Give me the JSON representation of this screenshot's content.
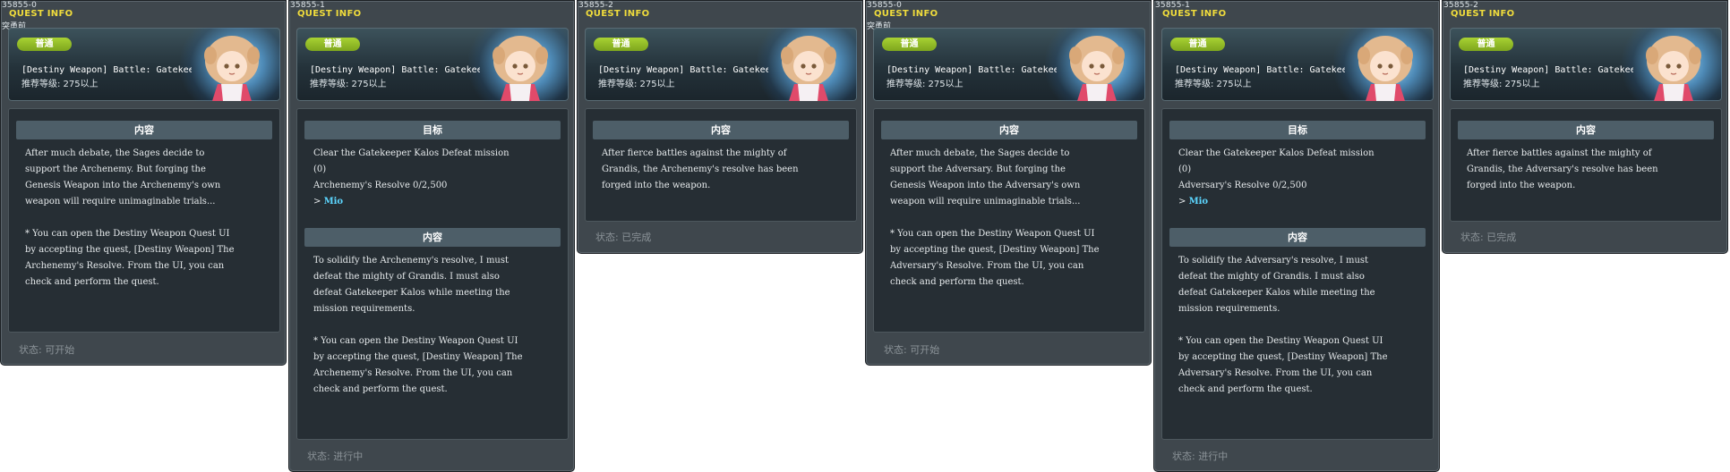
{
  "common": {
    "quest_info_label": "QUEST INFO",
    "badge": "普通",
    "title": "[Destiny Weapon] Battle: Gatekeeper Kalos",
    "level": "推荐等级: 275以上",
    "section_content": "内容",
    "section_goal": "目标"
  },
  "panels": [
    {
      "id": "35855-0",
      "subtitle": "突勇前",
      "sections": [
        {
          "header": "内容",
          "text": "After much debate, the Sages decide to\nsupport the Archenemy. But forging the\nGenesis Weapon into the Archenemy's own\nweapon will require unimaginable trials...\n\n * You can open the Destiny Weapon Quest UI\nby accepting the quest, [Destiny Weapon] The\nArchenemy's Resolve. From the UI, you can\ncheck and perform the quest."
        }
      ],
      "status": "状态: 可开始"
    },
    {
      "id": "35855-1",
      "goal_lines": [
        "Clear the Gatekeeper Kalos Defeat mission",
        "(0)",
        "Archenemy's Resolve 0/2,500"
      ],
      "goal_arrow": "> ",
      "goal_npc": "Mio",
      "content": "To solidify the Archenemy's resolve, I must\ndefeat the mighty of Grandis. I must also\ndefeat Gatekeeper Kalos while meeting the\nmission requirements.\n\n * You can open the Destiny Weapon Quest UI\nby accepting the quest, [Destiny Weapon] The\nArchenemy's Resolve. From the UI, you can\ncheck and perform the quest.",
      "status": "状态: 进行中"
    },
    {
      "id": "35855-2",
      "content": "After fierce battles against the mighty of\nGrandis, the Archenemy's resolve has been\nforged into the weapon.",
      "status": "状态: 已完成"
    },
    {
      "id": "35855-0",
      "subtitle": "突勇前",
      "content": "After much debate, the Sages decide to\nsupport the Adversary. But forging the\nGenesis Weapon into the Adversary's own\nweapon will require unimaginable trials...\n\n * You can open the Destiny Weapon Quest UI\nby accepting the quest, [Destiny Weapon] The\nAdversary's Resolve. From the UI, you can\ncheck and perform the quest.",
      "status": "状态: 可开始"
    },
    {
      "id": "35855-1",
      "goal_lines": [
        "Clear the Gatekeeper Kalos Defeat mission",
        "(0)",
        "Adversary's Resolve 0/2,500"
      ],
      "goal_arrow": "> ",
      "goal_npc": "Mio",
      "content": "To solidify the Adversary's resolve, I must\ndefeat the mighty of Grandis. I must also\ndefeat Gatekeeper Kalos while meeting the\nmission requirements.\n\n * You can open the Destiny Weapon Quest UI\nby accepting the quest, [Destiny Weapon] The\nAdversary's Resolve. From the UI, you can\ncheck and perform the quest.",
      "status": "状态: 进行中"
    },
    {
      "id": "35855-2",
      "content": "After fierce battles against the mighty of\nGrandis, the Adversary's resolve has been\nforged into the weapon.",
      "status": "状态: 已完成"
    }
  ]
}
